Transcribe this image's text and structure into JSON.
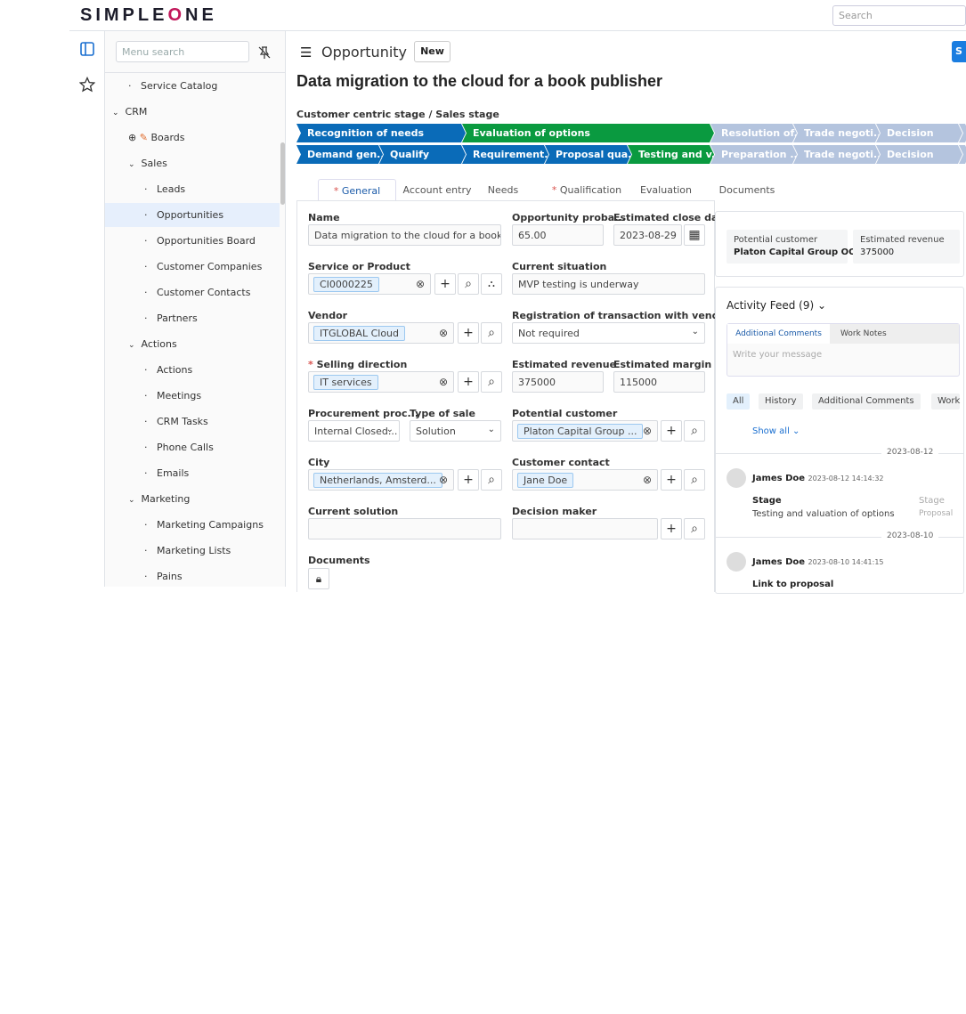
{
  "header": {
    "logo": "SIMPLEONE",
    "search_placeholder": "Search"
  },
  "rail": {
    "icons": [
      "sidebar-panel-icon",
      "star-icon"
    ]
  },
  "sidebar": {
    "search_placeholder": "Menu search",
    "items": [
      {
        "label": "Service Catalog",
        "level": 1,
        "type": "leaf"
      },
      {
        "label": "CRM",
        "level": 0,
        "type": "group"
      },
      {
        "label": "Boards",
        "level": 1,
        "type": "board"
      },
      {
        "label": "Sales",
        "level": 1,
        "type": "group"
      },
      {
        "label": "Leads",
        "level": 2,
        "type": "leaf"
      },
      {
        "label": "Opportunities",
        "level": 2,
        "type": "leaf",
        "selected": true
      },
      {
        "label": "Opportunities Board",
        "level": 2,
        "type": "leaf"
      },
      {
        "label": "Customer Companies",
        "level": 2,
        "type": "leaf"
      },
      {
        "label": "Customer Contacts",
        "level": 2,
        "type": "leaf"
      },
      {
        "label": "Partners",
        "level": 2,
        "type": "leaf"
      },
      {
        "label": "Actions",
        "level": 1,
        "type": "group"
      },
      {
        "label": "Actions",
        "level": 2,
        "type": "leaf"
      },
      {
        "label": "Meetings",
        "level": 2,
        "type": "leaf"
      },
      {
        "label": "CRM Tasks",
        "level": 2,
        "type": "leaf"
      },
      {
        "label": "Phone Calls",
        "level": 2,
        "type": "leaf"
      },
      {
        "label": "Emails",
        "level": 2,
        "type": "leaf"
      },
      {
        "label": "Marketing",
        "level": 1,
        "type": "group"
      },
      {
        "label": "Marketing Campaigns",
        "level": 2,
        "type": "leaf"
      },
      {
        "label": "Marketing Lists",
        "level": 2,
        "type": "leaf"
      },
      {
        "label": "Pains",
        "level": 2,
        "type": "leaf"
      }
    ]
  },
  "page": {
    "table_title": "Opportunity",
    "new_button": "New",
    "save_button": "S",
    "record_title": "Data migration to the cloud for a book publisher",
    "stage_label": "Customer centric stage / Sales stage"
  },
  "colors": {
    "done": "#0a6bb8",
    "current": "#0a9a40",
    "future": "#b4c4de"
  },
  "stages": {
    "row1": [
      {
        "label": "Recognition of needs",
        "state": "done"
      },
      {
        "label": "Evaluation of options",
        "state": "current"
      },
      {
        "label": "Resolution of...",
        "state": "future"
      },
      {
        "label": "Trade negoti...",
        "state": "future"
      },
      {
        "label": "Decision",
        "state": "future"
      },
      {
        "label": "",
        "state": "future"
      }
    ],
    "row2": [
      {
        "label": "Demand gen...",
        "state": "done"
      },
      {
        "label": "Qualify",
        "state": "done"
      },
      {
        "label": "Requirement...",
        "state": "done"
      },
      {
        "label": "Proposal qua...",
        "state": "done"
      },
      {
        "label": "Testing and v...",
        "state": "current"
      },
      {
        "label": "Preparation ...",
        "state": "future"
      },
      {
        "label": "Trade negoti...",
        "state": "future"
      },
      {
        "label": "Decision",
        "state": "future"
      },
      {
        "label": "",
        "state": "future"
      }
    ]
  },
  "tabs": [
    {
      "label": "General",
      "required": true,
      "active": true
    },
    {
      "label": "Account entry"
    },
    {
      "label": "Needs"
    },
    {
      "label": "Qualification",
      "required": true
    },
    {
      "label": "Evaluation"
    },
    {
      "label": "Documents"
    }
  ],
  "form": {
    "name": {
      "label": "Name",
      "value": "Data migration to the cloud for a book publ"
    },
    "probability": {
      "label": "Opportunity proba...",
      "value": "65.00"
    },
    "close_date": {
      "label": "Estimated close date",
      "value": "2023-08-29"
    },
    "service": {
      "label": "Service or Product",
      "value": "CI0000225"
    },
    "situation": {
      "label": "Current situation",
      "value": "MVP testing is underway"
    },
    "vendor": {
      "label": "Vendor",
      "value": "ITGLOBAL Cloud"
    },
    "registration": {
      "label": "Registration of transaction with vendor",
      "value": "Not required"
    },
    "selling": {
      "label": "Selling direction",
      "value": "IT services",
      "required": true
    },
    "est_revenue": {
      "label": "Estimated revenue",
      "value": "375000"
    },
    "est_margin": {
      "label": "Estimated margin",
      "value": "115000"
    },
    "procurement": {
      "label": "Procurement proc...",
      "value": "Internal Closed..."
    },
    "sale_type": {
      "label": "Type of sale",
      "value": "Solution"
    },
    "customer": {
      "label": "Potential customer",
      "value": "Platon Capital Group ..."
    },
    "city": {
      "label": "City",
      "value": "Netherlands, Amsterd..."
    },
    "contact": {
      "label": "Customer contact",
      "value": "Jane Doe"
    },
    "solution": {
      "label": "Current solution",
      "value": ""
    },
    "decision_maker": {
      "label": "Decision maker",
      "value": ""
    },
    "documents": {
      "label": "Documents"
    }
  },
  "summary": [
    {
      "label": "Potential customer",
      "value": "Platon Capital Group OOO"
    },
    {
      "label": "Estimated revenue",
      "value": "375000"
    }
  ],
  "activity": {
    "title": "Activity Feed (9)",
    "tabs": [
      "Additional Comments",
      "Work Notes"
    ],
    "placeholder": "Write your message",
    "filters": [
      "All",
      "History",
      "Additional Comments",
      "Work"
    ],
    "show_all": "Show all",
    "entries": [
      {
        "date": "2023-08-12",
        "author": "James Doe",
        "time": "2023-08-12 14:14:32",
        "field": "Stage",
        "new": "Testing and valuation of options",
        "old_field": "Stage",
        "old": "Proposal"
      },
      {
        "date": "2023-08-10",
        "author": "James Doe",
        "time": "2023-08-10 14:41:15",
        "field": "Link to proposal"
      }
    ]
  }
}
